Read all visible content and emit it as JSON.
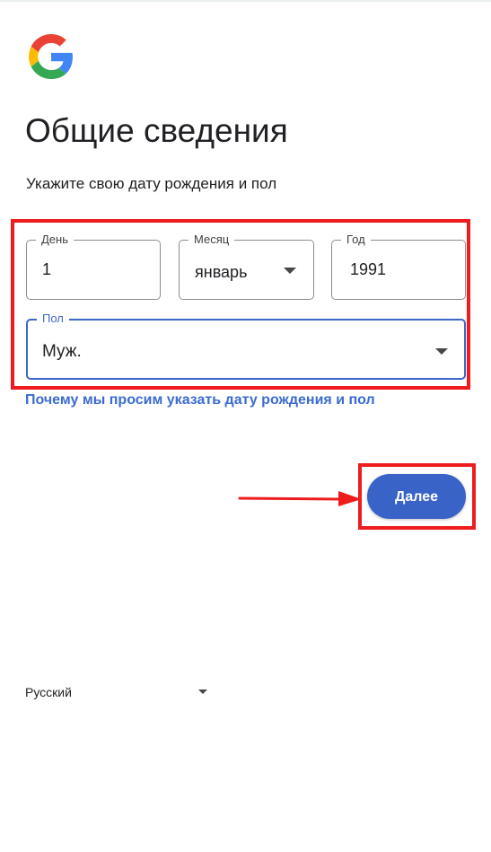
{
  "page": {
    "title": "Общие сведения",
    "subtitle": "Укажите свою дату рождения и пол"
  },
  "logo": {
    "icon": "google-g-logo",
    "colors": {
      "red": "#ea4335",
      "yellow": "#fbbc05",
      "green": "#34a853",
      "blue": "#4285f4"
    }
  },
  "form": {
    "day": {
      "label": "День",
      "value": "1"
    },
    "month": {
      "label": "Месяц",
      "value": "январь",
      "icon": "caret-down-icon"
    },
    "year": {
      "label": "Год",
      "value": "1991"
    },
    "gender": {
      "label": "Пол",
      "value": "Муж.",
      "icon": "caret-down-icon"
    },
    "why_link": "Почему мы просим указать дату рождения и пол"
  },
  "actions": {
    "next_label": "Далее"
  },
  "footer": {
    "language": "Русский",
    "language_icon": "caret-down-icon"
  },
  "annotations": {
    "highlight_color": "#ee1c1c",
    "arrow_icon": "red-arrow-right-icon"
  },
  "colors": {
    "accent": "#3a63c7",
    "link": "#3c6bd0",
    "focus_border": "#3c66c7",
    "text": "#202124"
  }
}
